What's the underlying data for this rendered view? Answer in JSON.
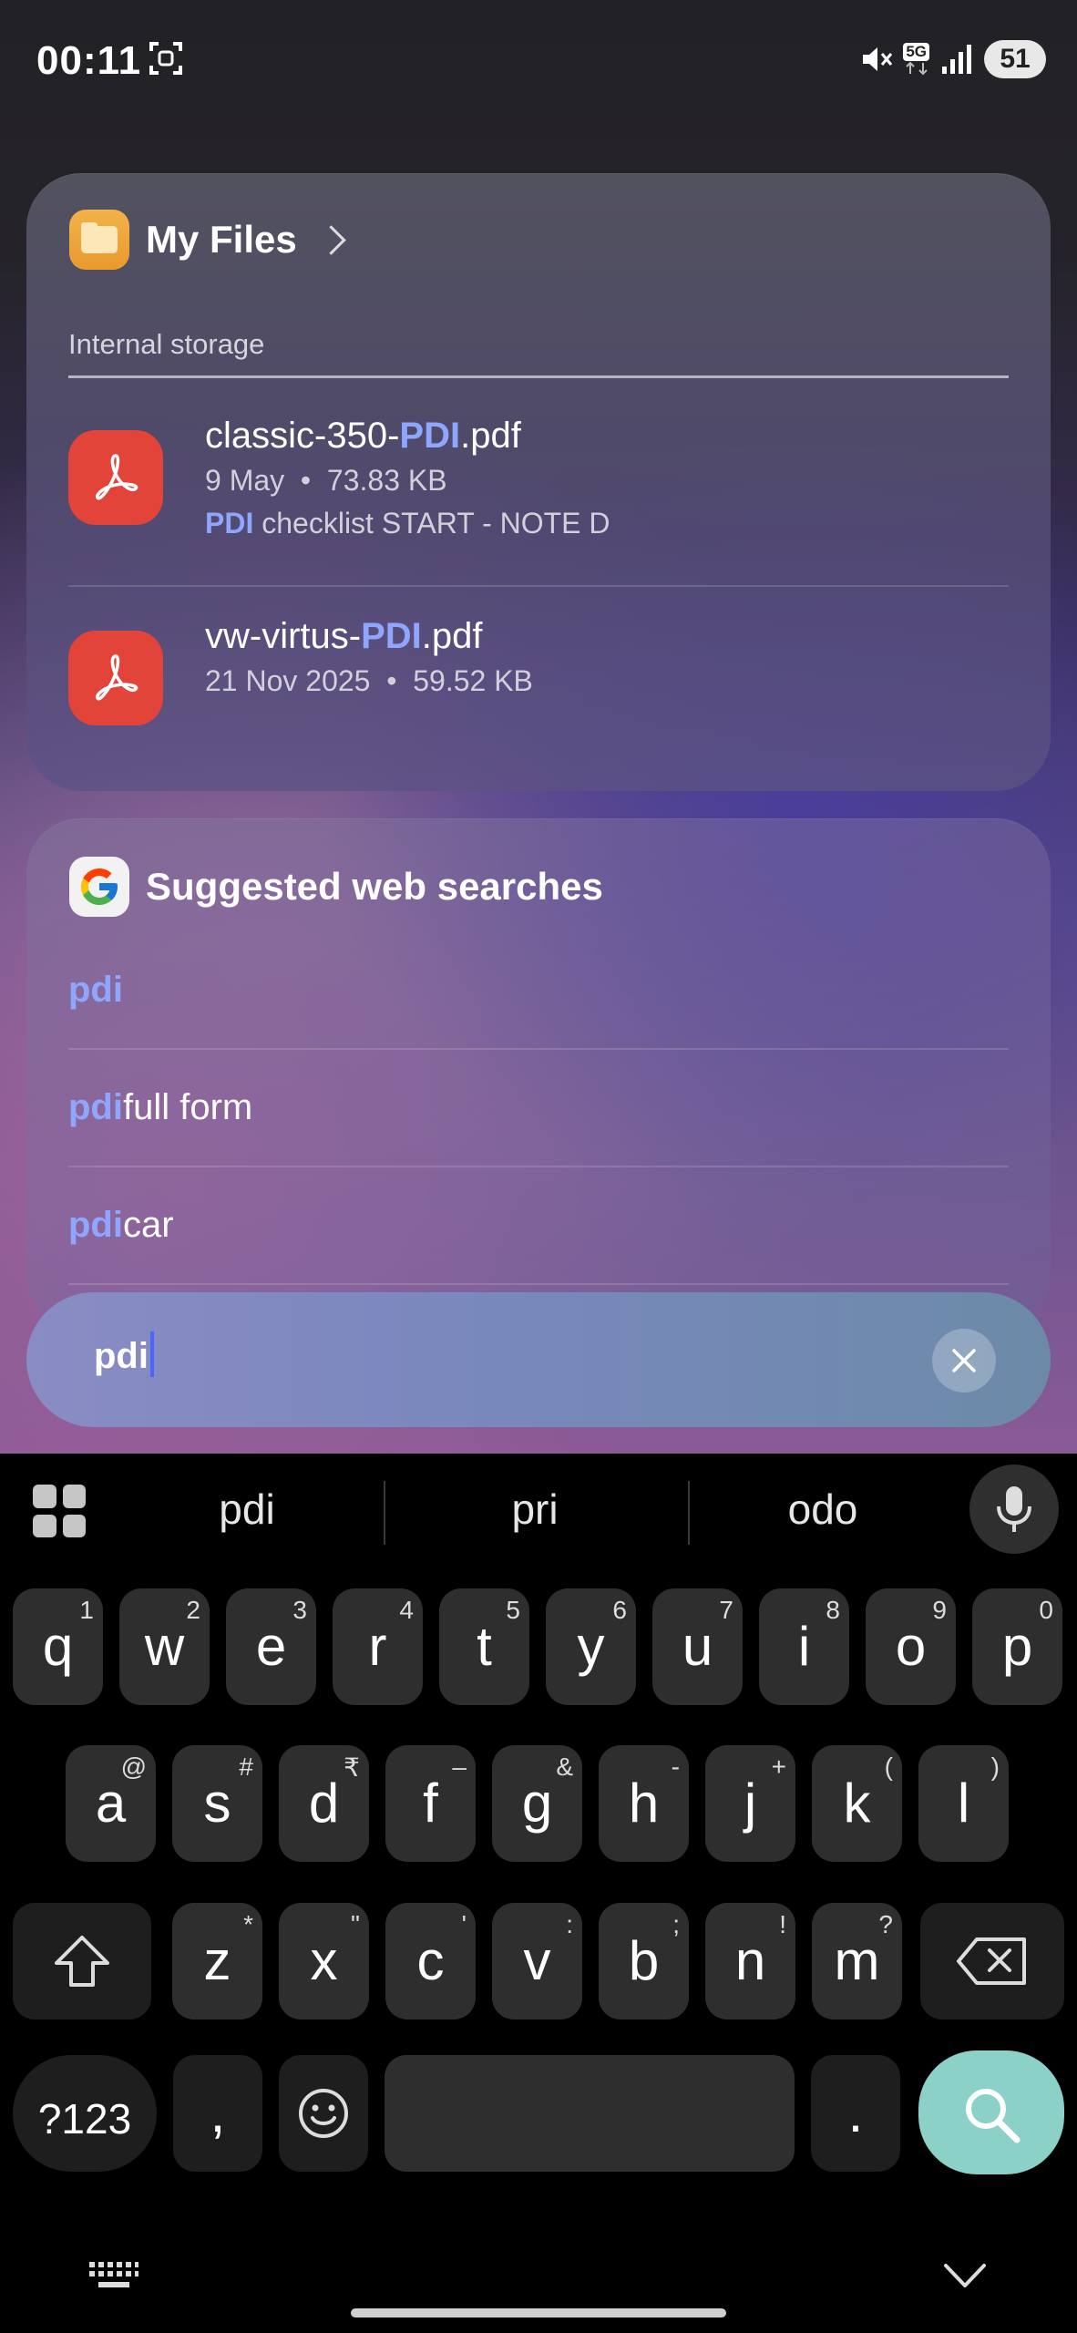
{
  "status_bar": {
    "time": "00:11",
    "network": "5G",
    "battery": "51"
  },
  "files_card": {
    "title": "My Files",
    "section": "Internal storage",
    "items": [
      {
        "name_prefix": "classic-350-",
        "name_match": "PDI",
        "name_suffix": ".pdf",
        "date": "9 May",
        "size": "73.83 KB",
        "snippet_match": "PDI",
        "snippet_rest": " checklist START - NOTE D"
      },
      {
        "name_prefix": "vw-virtus-",
        "name_match": "PDI",
        "name_suffix": ".pdf",
        "date": "21 Nov 2025",
        "size": "59.52 KB"
      }
    ]
  },
  "web_card": {
    "title": "Suggested web searches",
    "suggestions": [
      {
        "match": "pdi",
        "rest": ""
      },
      {
        "match": "pdi",
        "rest": " full form"
      },
      {
        "match": "pdi",
        "rest": " car"
      }
    ]
  },
  "search": {
    "query": "pdi"
  },
  "keyboard": {
    "word_suggestions": [
      "pdi",
      "pri",
      "odo"
    ],
    "row1": [
      {
        "k": "q",
        "s": "1"
      },
      {
        "k": "w",
        "s": "2"
      },
      {
        "k": "e",
        "s": "3"
      },
      {
        "k": "r",
        "s": "4"
      },
      {
        "k": "t",
        "s": "5"
      },
      {
        "k": "y",
        "s": "6"
      },
      {
        "k": "u",
        "s": "7"
      },
      {
        "k": "i",
        "s": "8"
      },
      {
        "k": "o",
        "s": "9"
      },
      {
        "k": "p",
        "s": "0"
      }
    ],
    "row2": [
      {
        "k": "a",
        "s": "@"
      },
      {
        "k": "s",
        "s": "#"
      },
      {
        "k": "d",
        "s": "₹"
      },
      {
        "k": "f",
        "s": "–"
      },
      {
        "k": "g",
        "s": "&"
      },
      {
        "k": "h",
        "s": "-"
      },
      {
        "k": "j",
        "s": "+"
      },
      {
        "k": "k",
        "s": "("
      },
      {
        "k": "l",
        "s": ")"
      }
    ],
    "row3": [
      {
        "k": "z",
        "s": "*"
      },
      {
        "k": "x",
        "s": "\""
      },
      {
        "k": "c",
        "s": "'"
      },
      {
        "k": "v",
        "s": ":"
      },
      {
        "k": "b",
        "s": ";"
      },
      {
        "k": "n",
        "s": "!"
      },
      {
        "k": "m",
        "s": "?"
      }
    ],
    "sym_label": "?123",
    "comma": ",",
    "period": "."
  },
  "colors": {
    "highlight": "#8fa6ff",
    "pdf_icon": "#e3443a",
    "go_key": "#8bd1c8"
  }
}
